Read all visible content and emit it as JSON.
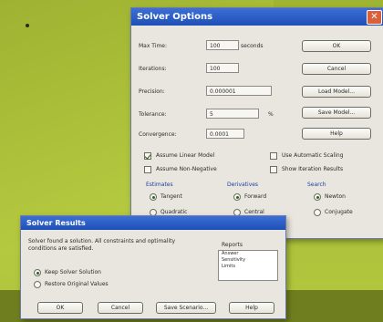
{
  "solver_options": {
    "title": "Solver Options",
    "max_time_label": "Max Time:",
    "max_time_value": "100",
    "max_time_unit": "seconds",
    "iterations_label": "Iterations:",
    "iterations_value": "100",
    "precision_label": "Precision:",
    "precision_value": "0.000001",
    "tolerance_label": "Tolerance:",
    "tolerance_value": "5",
    "tolerance_unit": "%",
    "convergence_label": "Convergence:",
    "convergence_value": "0.0001",
    "ok_label": "OK",
    "cancel_label": "Cancel",
    "load_model_label": "Load Model...",
    "save_model_label": "Save Model...",
    "help_label": "Help",
    "assume_linear_label": "Assume Linear Model",
    "assume_non_negative_label": "Assume Non-Negative",
    "use_automatic_scaling_label": "Use Automatic Scaling",
    "show_iteration_results_label": "Show Iteration Results",
    "estimates_label": "Estimates",
    "tangent_label": "Tangent",
    "quadratic_label": "Quadratic",
    "derivatives_label": "Derivatives",
    "forward_label": "Forward",
    "central_label": "Central",
    "search_label": "Search",
    "newton_label": "Newton",
    "conjugate_label": "Conjugate"
  },
  "solver_results": {
    "title": "Solver Results",
    "message_line1": "Solver found a solution.  All constraints and optimality",
    "message_line2": "conditions are satisfied.",
    "reports_label": "Reports",
    "reports": [
      "Answer",
      "Sensitivity",
      "Limits"
    ],
    "keep_label": "Keep Solver Solution",
    "restore_label": "Restore Original Values",
    "ok_label": "OK",
    "cancel_label": "Cancel",
    "save_scenario_label": "Save Scenario...",
    "help_label": "Help"
  },
  "colors": {
    "background": "#a9bd36",
    "titlebar": "#1e4fb7",
    "dialog": "#e9e6df"
  }
}
